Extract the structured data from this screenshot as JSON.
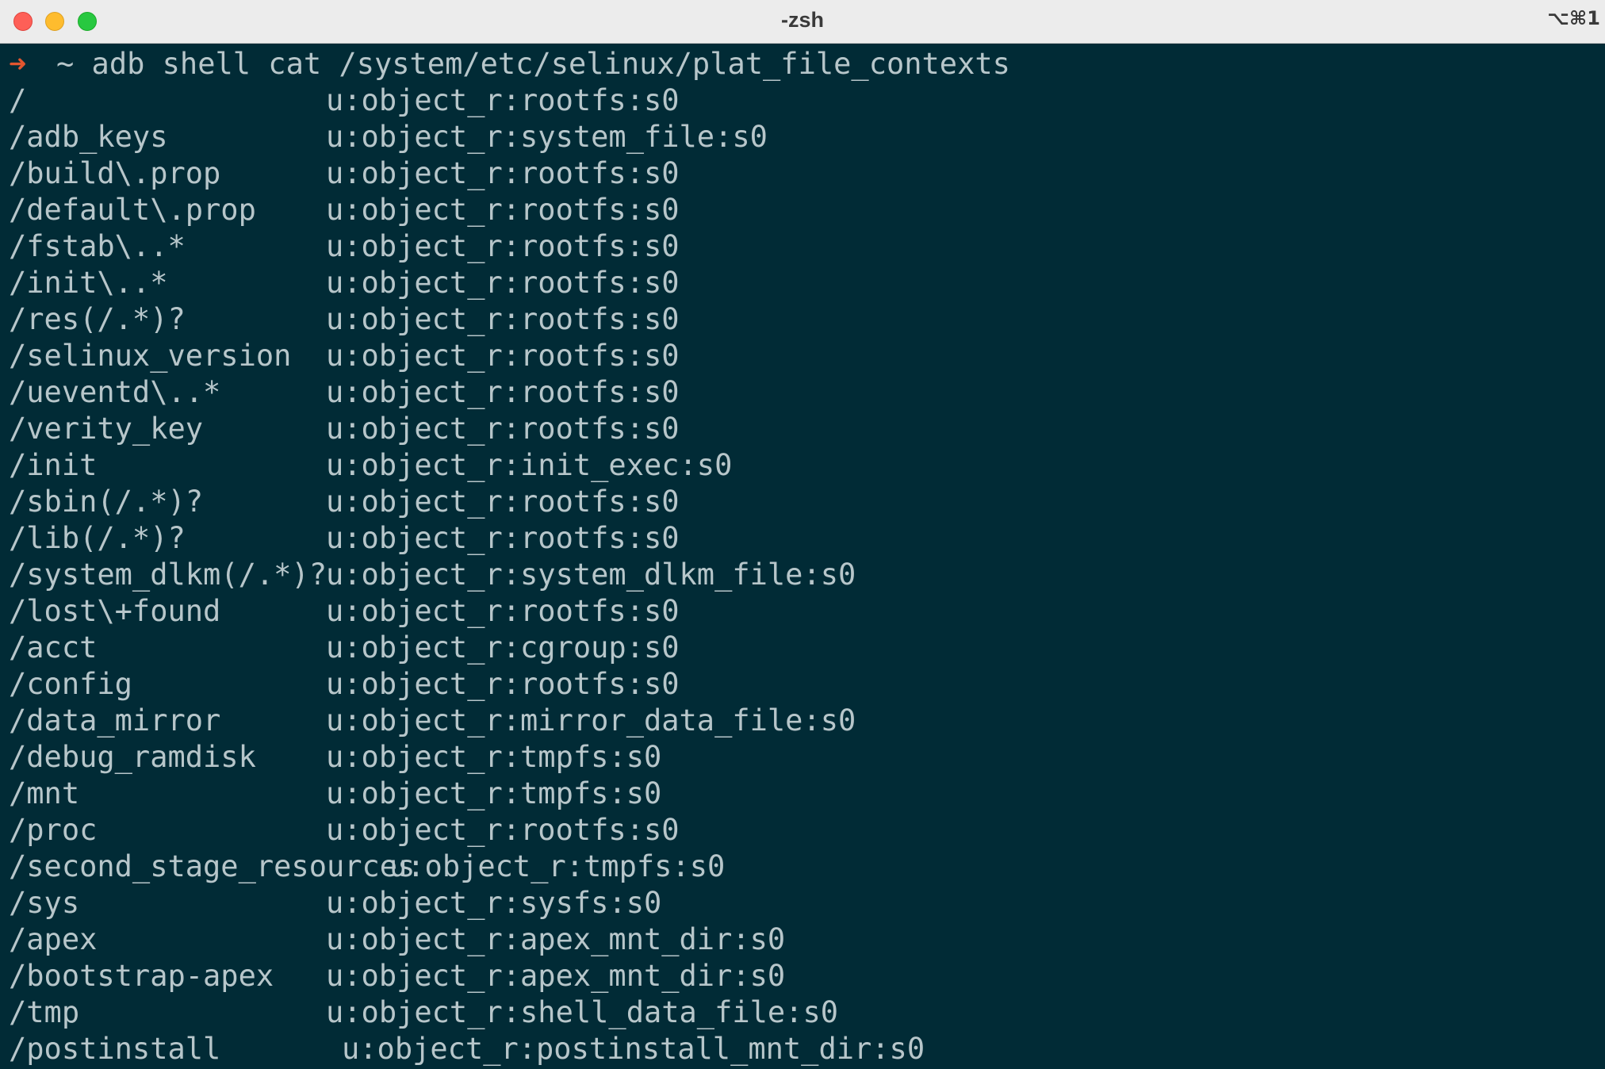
{
  "window": {
    "title": "-zsh",
    "shortcut": "⌥⌘1"
  },
  "prompt": {
    "arrow": "➜",
    "command": "~ adb shell cat /system/etc/selinux/plat_file_contexts"
  },
  "entries": [
    {
      "path": "/",
      "context": "u:object_r:rootfs:s0"
    },
    {
      "path": "/adb_keys",
      "context": "u:object_r:system_file:s0"
    },
    {
      "path": "/build\\.prop",
      "context": "u:object_r:rootfs:s0"
    },
    {
      "path": "/default\\.prop",
      "context": "u:object_r:rootfs:s0"
    },
    {
      "path": "/fstab\\..*",
      "context": "u:object_r:rootfs:s0"
    },
    {
      "path": "/init\\..*",
      "context": "u:object_r:rootfs:s0"
    },
    {
      "path": "/res(/.*)?",
      "context": "u:object_r:rootfs:s0"
    },
    {
      "path": "/selinux_version",
      "context": "u:object_r:rootfs:s0"
    },
    {
      "path": "/ueventd\\..*",
      "context": "u:object_r:rootfs:s0"
    },
    {
      "path": "/verity_key",
      "context": "u:object_r:rootfs:s0"
    },
    {
      "path": "/init",
      "context": "u:object_r:init_exec:s0"
    },
    {
      "path": "/sbin(/.*)?",
      "context": "u:object_r:rootfs:s0"
    },
    {
      "path": "/lib(/.*)?",
      "context": "u:object_r:rootfs:s0"
    },
    {
      "path": "/system_dlkm(/.*)?",
      "context": "u:object_r:system_dlkm_file:s0"
    },
    {
      "path": "/lost\\+found",
      "context": "u:object_r:rootfs:s0"
    },
    {
      "path": "/acct",
      "context": "u:object_r:cgroup:s0"
    },
    {
      "path": "/config",
      "context": "u:object_r:rootfs:s0"
    },
    {
      "path": "/data_mirror",
      "context": "u:object_r:mirror_data_file:s0"
    },
    {
      "path": "/debug_ramdisk",
      "context": "u:object_r:tmpfs:s0"
    },
    {
      "path": "/mnt",
      "context": "u:object_r:tmpfs:s0"
    },
    {
      "path": "/proc",
      "context": "u:object_r:rootfs:s0"
    },
    {
      "path": "/second_stage_resources",
      "context": "u:object_r:tmpfs:s0"
    },
    {
      "path": "/sys",
      "context": "u:object_r:sysfs:s0"
    },
    {
      "path": "/apex",
      "context": "u:object_r:apex_mnt_dir:s0"
    },
    {
      "path": "/bootstrap-apex",
      "context": "u:object_r:apex_mnt_dir:s0"
    },
    {
      "path": "/tmp",
      "context": "u:object_r:shell_data_file:s0"
    },
    {
      "path": "/postinstall",
      "context": "u:object_r:postinstall_mnt_dir:s0"
    }
  ]
}
